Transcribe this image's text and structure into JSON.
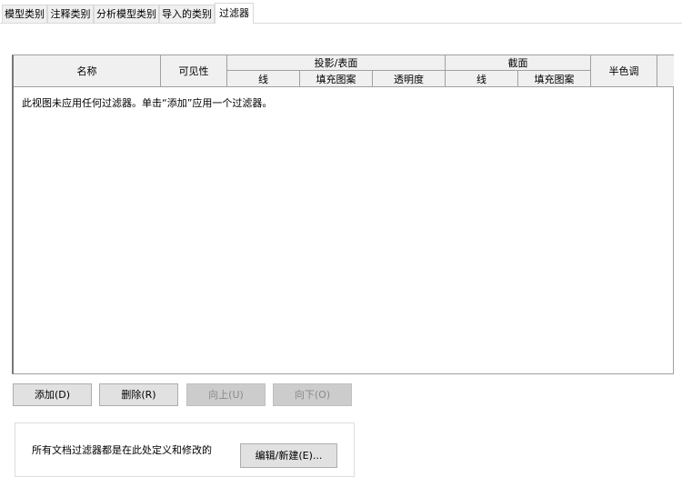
{
  "tabs": [
    "模型类别",
    "注释类别",
    "分析模型类别",
    "导入的类别",
    "过滤器"
  ],
  "active_tab": "过滤器",
  "table": {
    "headers": {
      "name": "名称",
      "visibility": "可见性",
      "projection": "投影/表面",
      "proj_line": "线",
      "proj_fill": "填充图案",
      "proj_transparency": "透明度",
      "cut": "截面",
      "cut_line": "线",
      "cut_fill": "填充图案",
      "halftone": "半色调"
    },
    "empty_message": "此视图未应用任何过滤器。单击“添加”应用一个过滤器。"
  },
  "buttons": {
    "add": "添加(D)",
    "delete": "删除(R)",
    "up": "向上(U)",
    "down": "向下(O)"
  },
  "footer": {
    "text": "所有文档过滤器都是在此处定义和修改的",
    "edit_button": "编辑/新建(E)..."
  }
}
